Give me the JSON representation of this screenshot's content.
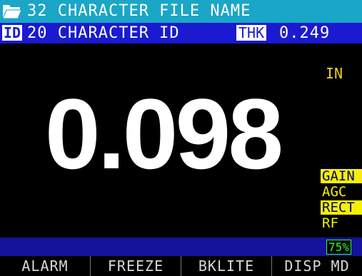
{
  "file_bar": {
    "icon": "folder-open-icon",
    "text": "32 CHARACTER FILE NAME"
  },
  "id_bar": {
    "id_tag": "ID",
    "text": "20 CHARACTER ID",
    "thk_tag": "THK",
    "thk_value": "0.249"
  },
  "main": {
    "reading": "0.098",
    "unit": "IN"
  },
  "side_status": [
    {
      "label": "GAIN",
      "highlighted": true
    },
    {
      "label": "AGC",
      "highlighted": false
    },
    {
      "label": "RECT",
      "highlighted": true
    },
    {
      "label": "RF",
      "highlighted": false
    }
  ],
  "status_bar": {
    "battery": "75%"
  },
  "softkeys": [
    {
      "label": "ALARM"
    },
    {
      "label": "FREEZE"
    },
    {
      "label": "BKLITE"
    },
    {
      "label": "DISP MD"
    }
  ],
  "colors": {
    "file_bar_bg": "#1aa6c6",
    "id_bar_bg": "#1a1ad0",
    "status_bar_bg": "#12129a",
    "highlight_yellow": "#f6f000",
    "battery_green": "#2fff2f"
  }
}
